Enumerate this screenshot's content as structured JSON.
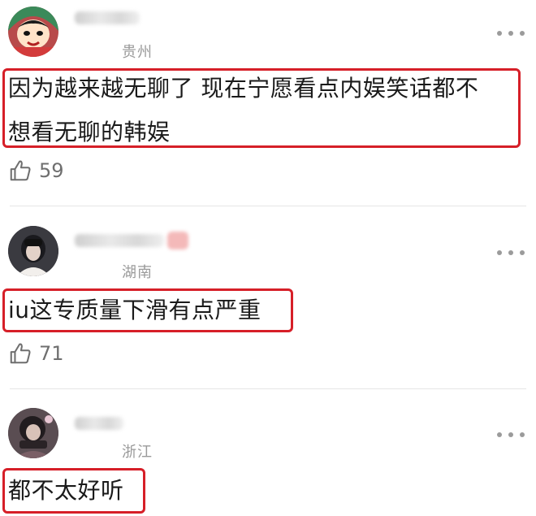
{
  "comments": [
    {
      "location": "贵州",
      "content_line1": "因为越来越无聊了 现在宁愿看点内娱笑话都不",
      "content_line2": "想看无聊的韩娱",
      "likes": "59",
      "avatar_icon": "cartoon-avatar-icon"
    },
    {
      "location": "湖南",
      "content_line1": "iu这专质量下滑有点严重",
      "likes": "71",
      "avatar_icon": "photo-avatar-icon"
    },
    {
      "location": "浙江",
      "content_line1": "都不太好听",
      "avatar_icon": "photo-avatar-icon"
    }
  ],
  "icons": {
    "more": "more-icon",
    "like": "thumbs-up-icon"
  },
  "colors": {
    "highlight_border": "#d61f28",
    "secondary_text": "#9a9a9a"
  }
}
